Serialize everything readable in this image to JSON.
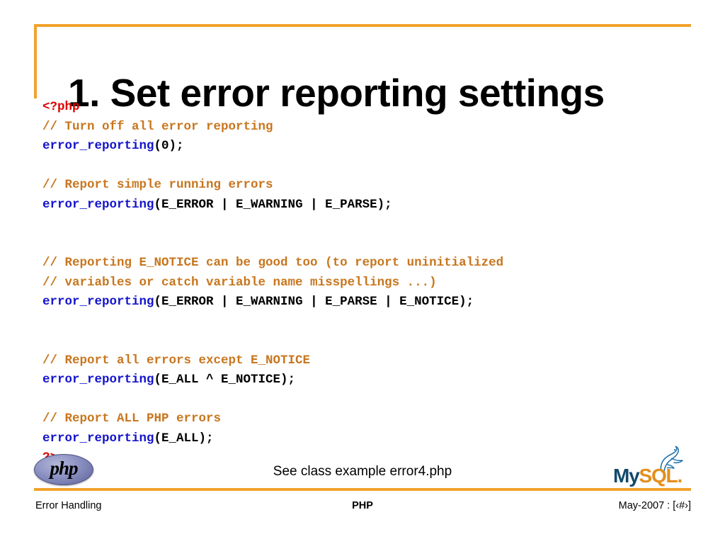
{
  "slide": {
    "title": "1. Set error reporting settings",
    "caption": "See class example error4.php",
    "accent_color": "#F2A22C"
  },
  "code": {
    "colors": {
      "tag": "#DD0000",
      "comment": "#C8761E",
      "function": "#1414CC",
      "plain": "#000000"
    },
    "lines": [
      {
        "type": "code",
        "segments": [
          {
            "cls": "tok-tag",
            "text": "<?php"
          }
        ]
      },
      {
        "type": "code",
        "segments": [
          {
            "cls": "tok-comment",
            "text": "// Turn off all error reporting"
          }
        ]
      },
      {
        "type": "code",
        "segments": [
          {
            "cls": "tok-func",
            "text": "error_reporting"
          },
          {
            "cls": "tok-plain",
            "text": "(0);"
          }
        ]
      },
      {
        "type": "blank",
        "segments": []
      },
      {
        "type": "code",
        "segments": [
          {
            "cls": "tok-comment",
            "text": "// Report simple running errors"
          }
        ]
      },
      {
        "type": "code",
        "segments": [
          {
            "cls": "tok-func",
            "text": "error_reporting"
          },
          {
            "cls": "tok-plain",
            "text": "(E_ERROR | E_WARNING | E_PARSE);"
          }
        ]
      },
      {
        "type": "blank",
        "segments": []
      },
      {
        "type": "blank",
        "segments": []
      },
      {
        "type": "code",
        "segments": [
          {
            "cls": "tok-comment",
            "text": "// Reporting E_NOTICE can be good too (to report uninitialized"
          }
        ]
      },
      {
        "type": "code",
        "segments": [
          {
            "cls": "tok-comment",
            "text": "// variables or catch variable name misspellings ...)"
          }
        ]
      },
      {
        "type": "code",
        "segments": [
          {
            "cls": "tok-func",
            "text": "error_reporting"
          },
          {
            "cls": "tok-plain",
            "text": "(E_ERROR | E_WARNING | E_PARSE | E_NOTICE);"
          }
        ]
      },
      {
        "type": "blank",
        "segments": []
      },
      {
        "type": "blank",
        "segments": []
      },
      {
        "type": "code",
        "segments": [
          {
            "cls": "tok-comment",
            "text": "// Report all errors except E_NOTICE"
          }
        ]
      },
      {
        "type": "code",
        "segments": [
          {
            "cls": "tok-func",
            "text": "error_reporting"
          },
          {
            "cls": "tok-plain",
            "text": "(E_ALL ^ E_NOTICE);"
          }
        ]
      },
      {
        "type": "blank",
        "segments": []
      },
      {
        "type": "code",
        "segments": [
          {
            "cls": "tok-comment",
            "text": "// Report ALL PHP errors"
          }
        ]
      },
      {
        "type": "code",
        "segments": [
          {
            "cls": "tok-func",
            "text": "error_reporting"
          },
          {
            "cls": "tok-plain",
            "text": "(E_ALL);"
          }
        ]
      },
      {
        "type": "code",
        "segments": [
          {
            "cls": "tok-tag",
            "text": "?>"
          }
        ]
      }
    ]
  },
  "logos": {
    "php": {
      "wordmark": "php",
      "fill_color": "#7B80B8"
    },
    "mysql": {
      "my": "My",
      "sql": "SQL.",
      "my_color": "#13496B",
      "sql_color": "#E48E1B"
    }
  },
  "footer": {
    "left": "Error Handling",
    "center": "PHP",
    "right": "May-2007 : [‹#›]"
  }
}
